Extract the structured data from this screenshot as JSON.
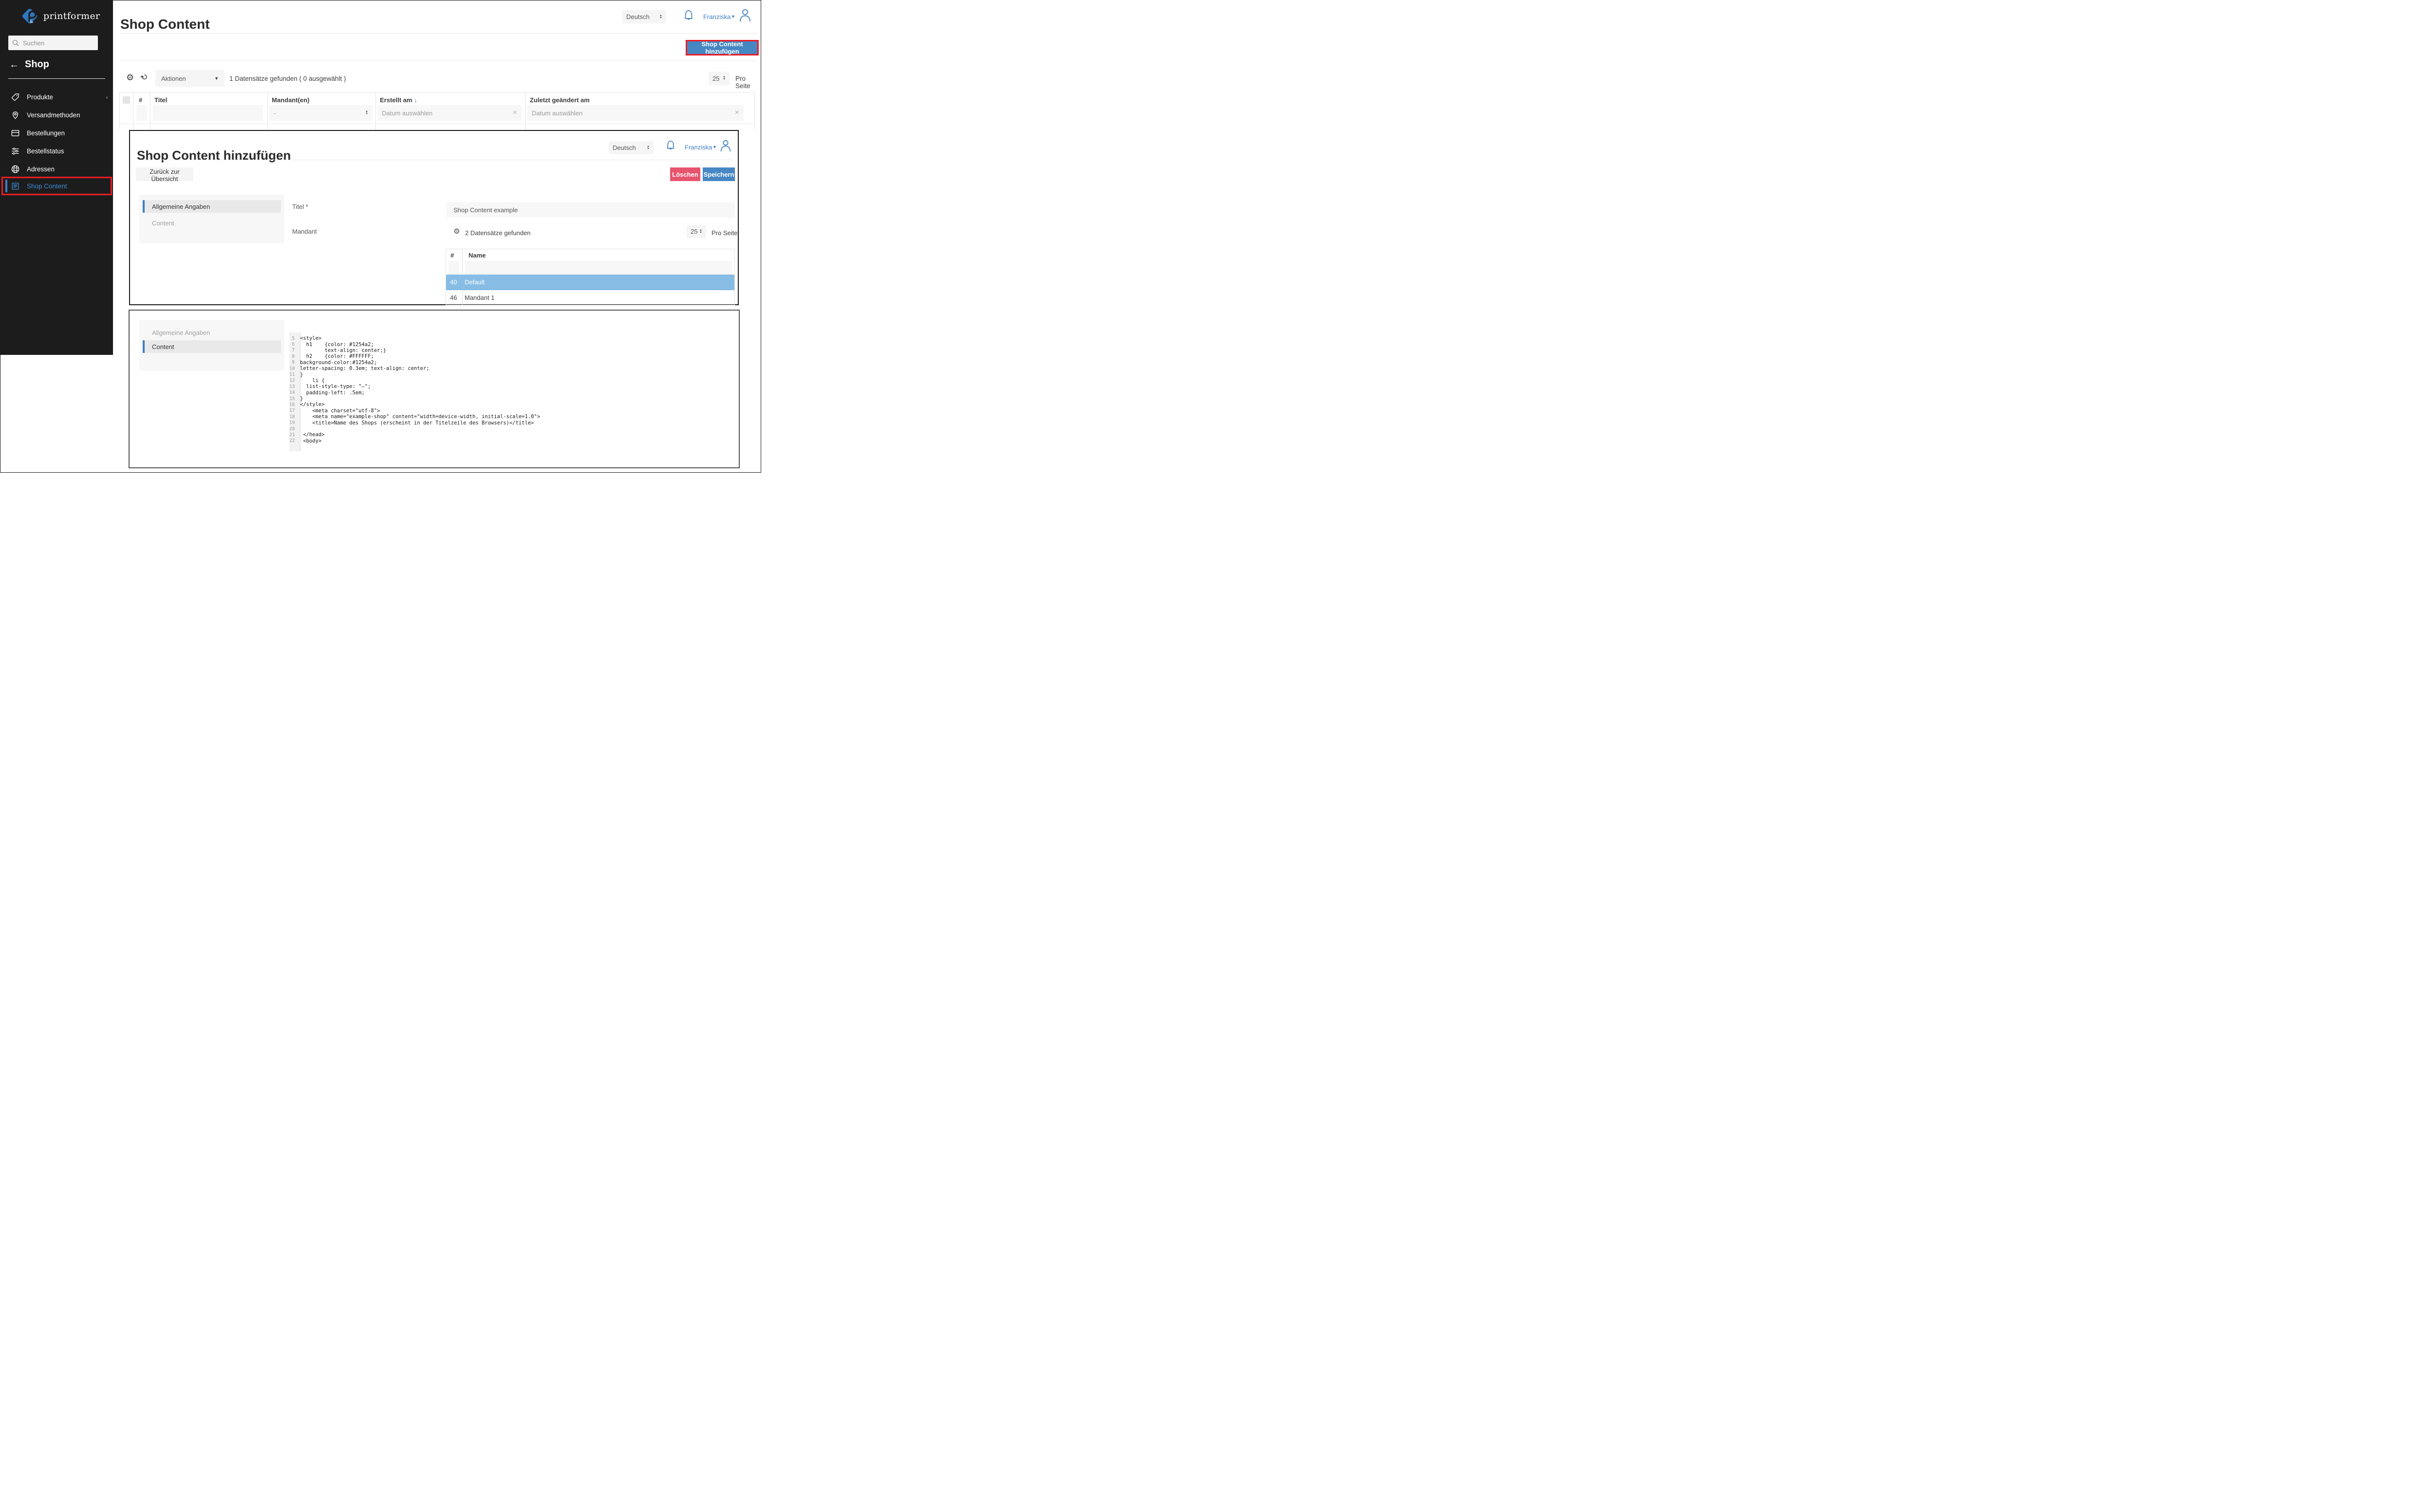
{
  "colors": {
    "sidebar_bg": "#1d1c1d",
    "brand_blue": "#4687c3",
    "link_blue": "#3e7fc1",
    "active_blue": "#2e7cc2",
    "delete_pink": "#e8536e",
    "row_highlight_blue": "#87bde5",
    "annotation_red": "#ed1c24"
  },
  "sidebar": {
    "logo_text": "printformer",
    "search_placeholder": "Suchen",
    "back_label": "Shop",
    "items": [
      {
        "label": "Produkte"
      },
      {
        "label": "Versandmethoden"
      },
      {
        "label": "Bestellungen"
      },
      {
        "label": "Bestellstatus"
      },
      {
        "label": "Adressen"
      },
      {
        "label": "Shop Content"
      }
    ]
  },
  "header": {
    "title": "Shop Content",
    "language": "Deutsch",
    "user": "Franziska",
    "add_button": "Shop Content hinzufügen"
  },
  "list_toolbar": {
    "actions_label": "Aktionen",
    "result_text": "1 Datensätze gefunden ( 0 ausgewählt )",
    "page_size": "25",
    "per_page_label": "Pro Seite"
  },
  "table": {
    "columns": [
      {
        "label": "#"
      },
      {
        "label": "Titel"
      },
      {
        "label": "Mandant(en)"
      },
      {
        "label": "Erstellt am"
      },
      {
        "label": "Zuletzt geändert am"
      }
    ],
    "sort_arrow": "↓",
    "mandant_filter_value": "-",
    "date_placeholder": "Datum auswählen"
  },
  "dialog": {
    "title": "Shop Content hinzufügen",
    "language": "Deutsch",
    "user": "Franziska",
    "back_button": "Zurück zur Übersicht",
    "delete_button": "Löschen",
    "save_button": "Speichern",
    "nav": [
      {
        "label": "Allgemeine Angaben"
      },
      {
        "label": "Content"
      }
    ],
    "titel_label": "Titel *",
    "titel_value": "Shop Content example",
    "mandant_label": "Mandant",
    "toolbar": {
      "result_text": "2 Datensätze gefunden",
      "page_size": "25",
      "per_page_label": "Pro Seite"
    },
    "table": {
      "col_id": "#",
      "col_name": "Name",
      "rows": [
        {
          "id": "40",
          "name": "Default"
        },
        {
          "id": "46",
          "name": "Mandant 1"
        }
      ]
    }
  },
  "content_panel": {
    "nav": [
      {
        "label": "Allgemeine Angaben"
      },
      {
        "label": "Content"
      }
    ],
    "code": {
      "lines": [
        {
          "num": "5",
          "text": "<style>"
        },
        {
          "num": "6",
          "text": "  h1    {color: #1254a2;"
        },
        {
          "num": "7",
          "text": "        text-align: center;}"
        },
        {
          "num": "8",
          "text": "  h2    {color: #FFFFFF;"
        },
        {
          "num": "9",
          "text": "background-color:#1254a2;"
        },
        {
          "num": "10",
          "text": "letter-spacing: 0.3em; text-align: center;"
        },
        {
          "num": "11",
          "text": "}"
        },
        {
          "num": "12",
          "text": "    li {"
        },
        {
          "num": "13",
          "text": "  list-style-type: \"—\";"
        },
        {
          "num": "14",
          "text": "  padding-left: .5em;"
        },
        {
          "num": "15",
          "text": "}"
        },
        {
          "num": "16",
          "text": "</style>"
        },
        {
          "num": "17",
          "text": "    <meta charset=\"utf-8\">"
        },
        {
          "num": "18",
          "text": "    <meta name=\"example-shop\" content=\"width=device-width, initial-scale=1.0\">"
        },
        {
          "num": "19",
          "text": "    <title>Name des Shops (erscheint in der Titelzeile des Browsers)</title>"
        },
        {
          "num": "20",
          "text": ""
        },
        {
          "num": "21",
          "text": " </head>"
        },
        {
          "num": "22",
          "text": " <body>"
        }
      ]
    }
  }
}
